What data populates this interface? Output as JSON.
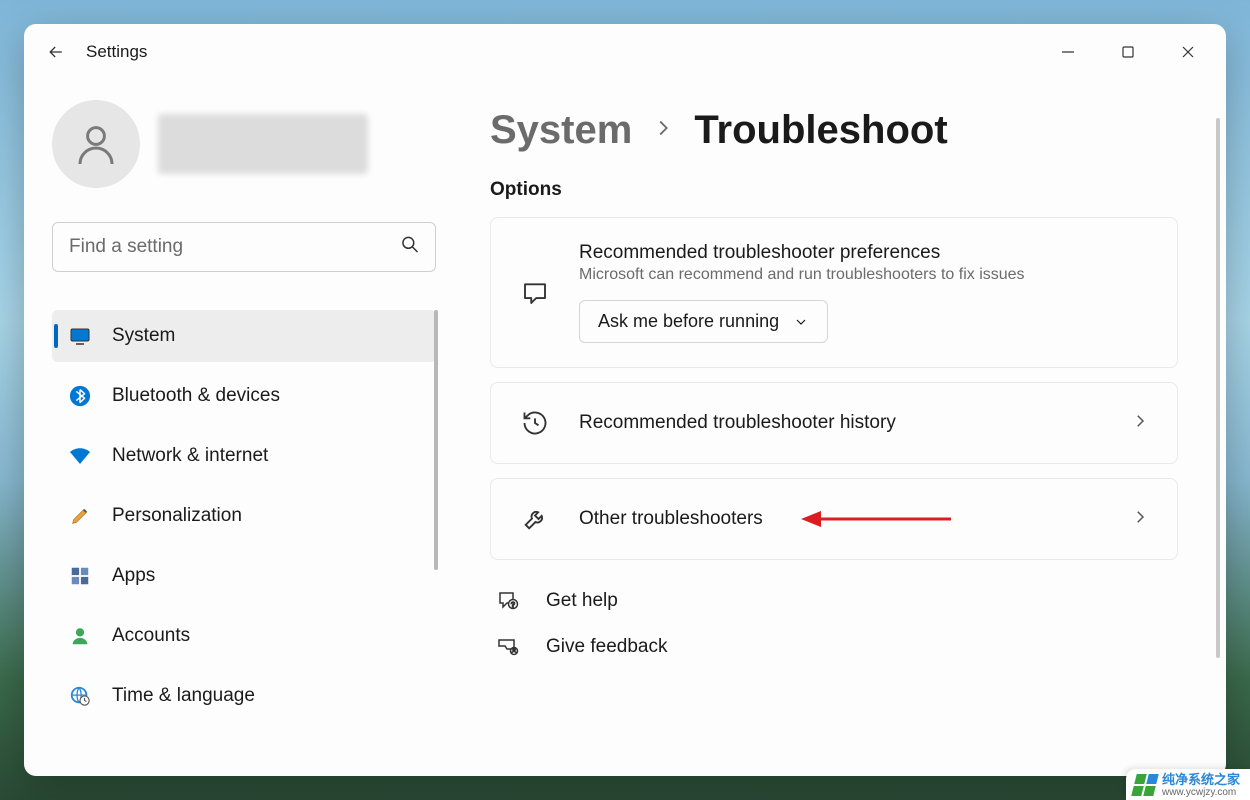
{
  "app_title": "Settings",
  "search": {
    "placeholder": "Find a setting"
  },
  "sidebar": {
    "items": [
      {
        "label": "System"
      },
      {
        "label": "Bluetooth & devices"
      },
      {
        "label": "Network & internet"
      },
      {
        "label": "Personalization"
      },
      {
        "label": "Apps"
      },
      {
        "label": "Accounts"
      },
      {
        "label": "Time & language"
      }
    ]
  },
  "breadcrumb": {
    "parent": "System",
    "current": "Troubleshoot"
  },
  "section": {
    "options_title": "Options"
  },
  "cards": {
    "pref": {
      "title": "Recommended troubleshooter preferences",
      "subtitle": "Microsoft can recommend and run troubleshooters to fix issues",
      "dropdown_value": "Ask me before running"
    },
    "history": {
      "title": "Recommended troubleshooter history"
    },
    "other": {
      "title": "Other troubleshooters"
    }
  },
  "links": {
    "help": "Get help",
    "feedback": "Give feedback"
  },
  "watermark": {
    "line1": "纯净系统之家",
    "line2": "www.ycwjzy.com"
  }
}
